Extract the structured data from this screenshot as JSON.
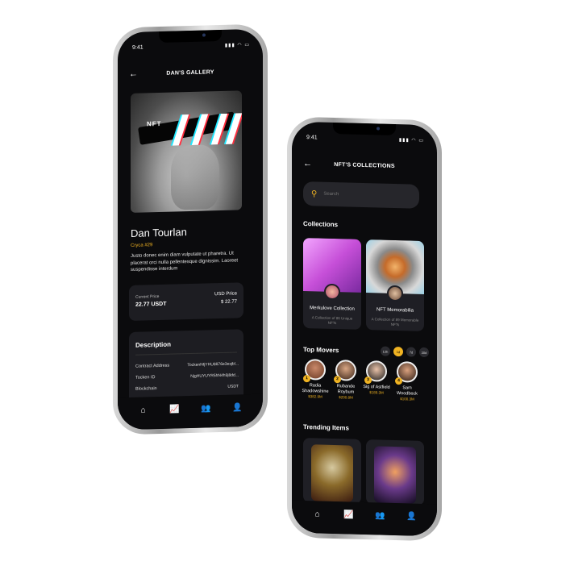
{
  "left_phone": {
    "time": "9:41",
    "signal": "▮▮▮ ◠ ▭",
    "title": "DAN'S GALLERY",
    "art_badge": "NFT",
    "artist_name": "Dan Tourlan",
    "collection": "Cryca #29",
    "description": "Justo donec enim diam vulputate ut pharetra. Ut placerat orci nulla pellentesque dignissim. Laoreet suspendisse interdum",
    "price": {
      "current_label": "Current Price",
      "current_value": "22.77 USDT",
      "usd_label": "USD Price",
      "usd_value": "$ 22.77"
    },
    "details": {
      "heading": "Description",
      "rows": [
        {
          "label": "Contract Address",
          "value": "TockenNfjYHU8876e3esjbl..."
        },
        {
          "label": "Tocken ID",
          "value": "NjgHUYUYR5hN4h9j8dd..."
        },
        {
          "label": "Blockchain",
          "value": "USDT"
        }
      ]
    }
  },
  "right_phone": {
    "time": "9:41",
    "signal": "▮▮▮ ◠ ▭",
    "title": "NFT'S COLLECTIONS",
    "search_placeholder": "Search",
    "collections_heading": "Collections",
    "collections": [
      {
        "title": "Merkulove Collection",
        "subtitle": "A Collection of 86 Unique NFTs"
      },
      {
        "title": "NFT Memorabilia",
        "subtitle": "A Collection of 89 Memorable NFTs"
      }
    ],
    "top_movers_heading": "Top Movers",
    "time_filters": [
      "12h",
      "1d",
      "7d",
      "30d"
    ],
    "movers": [
      {
        "rank": "1",
        "name": "Radia Shadowshine",
        "value": "$382.9M"
      },
      {
        "rank": "2",
        "name": "Rubande Roybum",
        "value": "$200.8M"
      },
      {
        "rank": "3",
        "name": "Sig of Astfield",
        "value": "$189.3M"
      },
      {
        "rank": "4",
        "name": "Sam Woodbeck",
        "value": "$100.3M"
      }
    ],
    "trending_heading": "Trending Items"
  },
  "tabs": {
    "home_icon": "⌂",
    "chart_icon": "📈",
    "community_icon": "👥",
    "profile_icon": "👤"
  },
  "colors": {
    "accent": "#f0b322",
    "screen": "#0b0b0d",
    "card": "#1d1d22"
  }
}
